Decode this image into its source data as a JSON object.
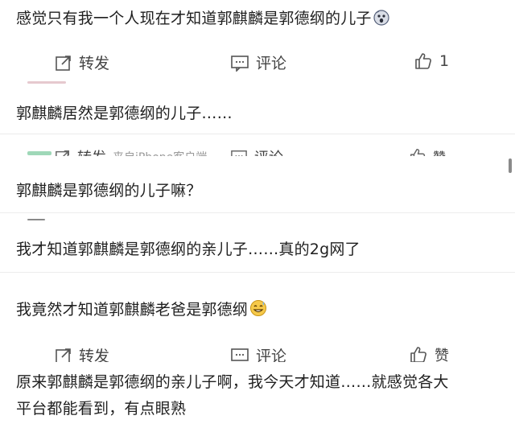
{
  "comments": [
    {
      "text": "感觉只有我一个人现在才知道郭麒麟是郭德纲的儿子"
    },
    {
      "text": "郭麒麟居然是郭德纲的儿子……"
    },
    {
      "text": "郭麒麟是郭德纲的儿子嘛？"
    },
    {
      "text": "我才知道郭麒麟是郭德纲的亲儿子……真的2g网了"
    },
    {
      "text": "我竟然才知道郭麒麟老爸是郭德纲"
    },
    {
      "text_line1": "原来郭麒麟是郭德纲的亲儿子啊，我今天才知道……就感觉各大",
      "text_line2": "平台都能看到，有点眼熟"
    }
  ],
  "action_bar_1": {
    "repost": "转发",
    "comment": "评论",
    "like_count": "1"
  },
  "action_bar_2": {
    "repost": "转发",
    "source": "来自iPhone客户端",
    "comment": "评论",
    "like": "赞"
  },
  "action_bar_3": {
    "repost": "转发",
    "comment": "评论",
    "like": "赞"
  },
  "icons": {
    "repost": "repost-icon",
    "comment": "comment-icon",
    "like": "thumbs-up-icon",
    "emoji_1": "surprised-face-emoji",
    "emoji_2": "grinning-sweat-emoji"
  },
  "colors": {
    "text": "#1f1f1f",
    "action": "#444444",
    "divider": "#ececec"
  }
}
